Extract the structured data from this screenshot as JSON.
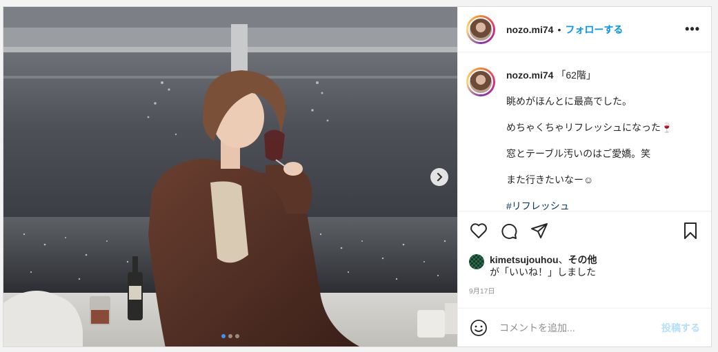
{
  "photo": {
    "alt_icon": "next-arrow-icon",
    "slides": [
      {
        "active": true
      },
      {
        "active": false
      },
      {
        "active": false
      }
    ]
  },
  "header": {
    "username": "nozo.mi74",
    "separator": "•",
    "follow_label": "フォローする",
    "more_label": "•••"
  },
  "caption": {
    "username": "nozo.mi74",
    "lines": [
      "「62階」",
      "眺めがほんとに最高でした。",
      "めちゃくちゃリフレッシュになった🍷",
      "窓とテーブル汚いのはご愛嬌。笑",
      "また行きたいなー☺",
      "#リフレッシュ"
    ]
  },
  "likes": {
    "name": "kimetsujouhou",
    "joiner": "、",
    "others": "その他",
    "suffix": "が「いいね！」しました"
  },
  "date": "9月17日",
  "comment": {
    "placeholder": "コメントを追加...",
    "post_label": "投稿する"
  },
  "colors": {
    "link_blue": "#0095f6",
    "post_disabled": "#b2dffc"
  }
}
